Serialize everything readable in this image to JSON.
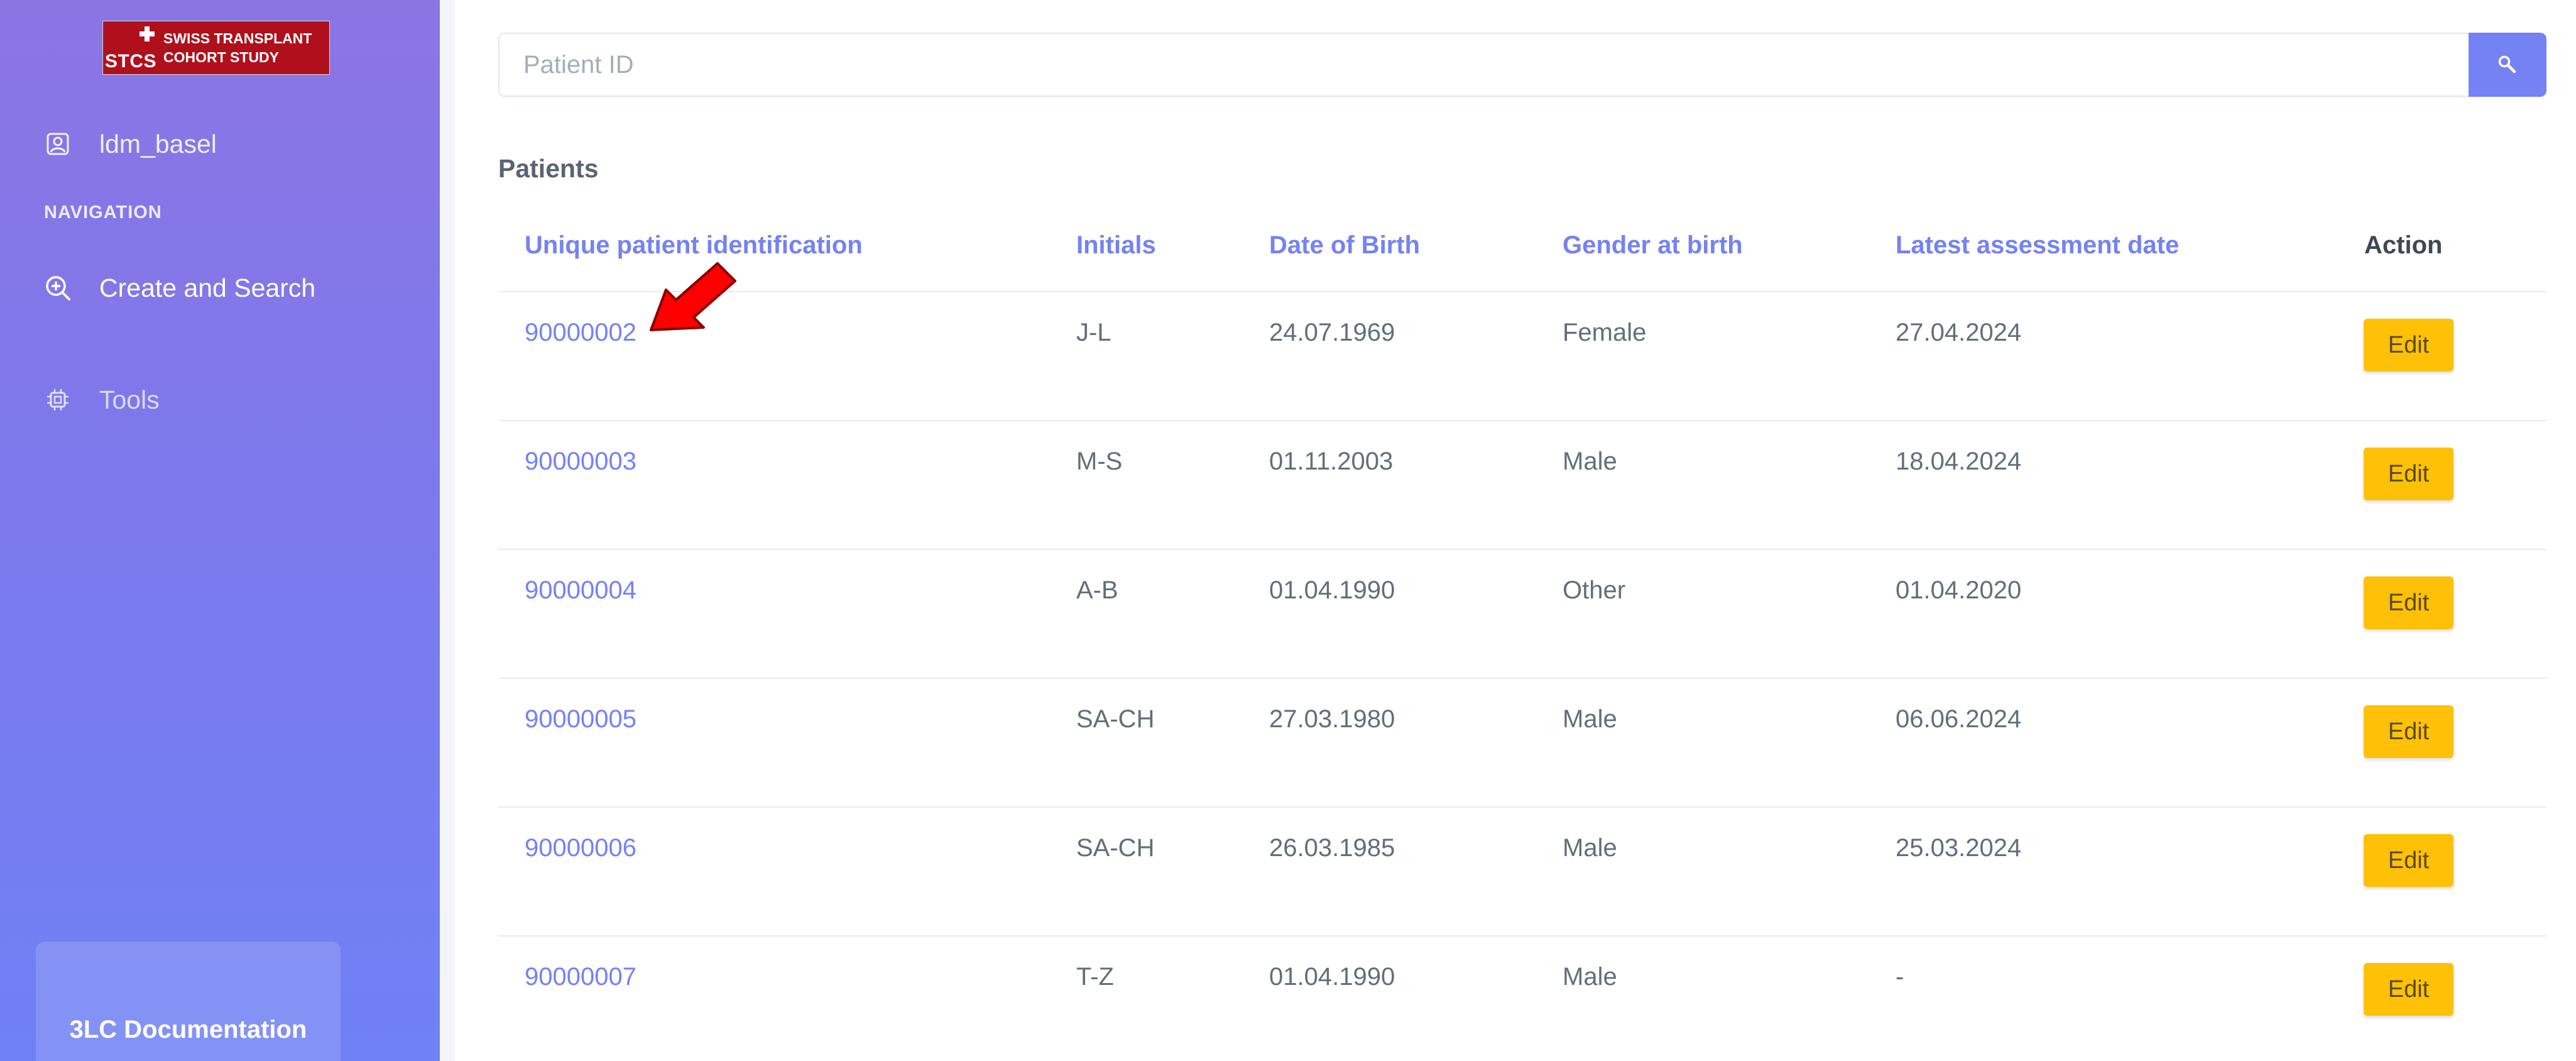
{
  "sidebar": {
    "logo": {
      "abbr": "STCS",
      "line1": "SWISS TRANSPLANT",
      "line2": "COHORT STUDY"
    },
    "user_label": "ldm_basel",
    "section_label": "NAVIGATION",
    "nav_items": [
      {
        "label": "Create and Search",
        "icon": "search-plus-icon"
      },
      {
        "label": "Tools",
        "icon": "chip-icon"
      }
    ],
    "doc_label": "3LC Documentation"
  },
  "search": {
    "placeholder": "Patient ID",
    "value": "",
    "button_icon": "search-icon"
  },
  "patients": {
    "title": "Patients",
    "columns": [
      "Unique patient identification",
      "Initials",
      "Date of Birth",
      "Gender at birth",
      "Latest assessment date",
      "Action"
    ],
    "rows": [
      {
        "id": "90000002",
        "initials": "J-L",
        "dob": "24.07.1969",
        "gender": "Female",
        "latest": "27.04.2024",
        "action": "Edit"
      },
      {
        "id": "90000003",
        "initials": "M-S",
        "dob": "01.11.2003",
        "gender": "Male",
        "latest": "18.04.2024",
        "action": "Edit"
      },
      {
        "id": "90000004",
        "initials": "A-B",
        "dob": "01.04.1990",
        "gender": "Other",
        "latest": "01.04.2020",
        "action": "Edit"
      },
      {
        "id": "90000005",
        "initials": "SA-CH",
        "dob": "27.03.1980",
        "gender": "Male",
        "latest": "06.06.2024",
        "action": "Edit"
      },
      {
        "id": "90000006",
        "initials": "SA-CH",
        "dob": "26.03.1985",
        "gender": "Male",
        "latest": "25.03.2024",
        "action": "Edit"
      },
      {
        "id": "90000007",
        "initials": "T-Z",
        "dob": "01.04.1990",
        "gender": "Male",
        "latest": "-",
        "action": "Edit"
      }
    ]
  },
  "colors": {
    "sidebar_top": "#8b75e3",
    "sidebar_bottom": "#6f81f5",
    "accent": "#7482f3",
    "edit_button": "#ffc107",
    "annotation_arrow": "#ff0000"
  }
}
